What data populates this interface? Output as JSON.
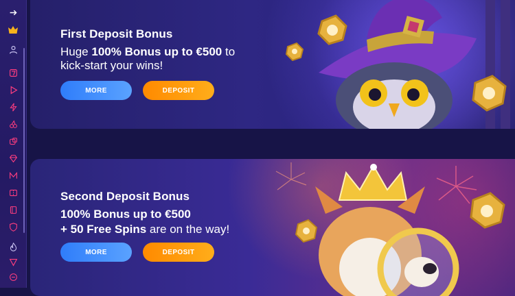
{
  "sidebar": {
    "items": [
      {
        "icon": "arrow-right-icon"
      },
      {
        "icon": "crown-icon"
      },
      {
        "icon": "user-icon"
      },
      {
        "icon": "slot-seven-icon"
      },
      {
        "icon": "play-icon"
      },
      {
        "icon": "lightning-icon"
      },
      {
        "icon": "cherry-icon"
      },
      {
        "icon": "dice-icon"
      },
      {
        "icon": "diamond-icon"
      },
      {
        "icon": "m-logo-icon"
      },
      {
        "icon": "ticket-icon"
      },
      {
        "icon": "book-icon"
      },
      {
        "icon": "shield-icon"
      },
      {
        "icon": "flame-icon"
      },
      {
        "icon": "triangle-down-icon"
      },
      {
        "icon": "chat-icon"
      }
    ]
  },
  "cards": [
    {
      "title": "First Deposit Bonus",
      "line1_prefix": "Huge ",
      "line1_bold": "100% Bonus up to €500",
      "line1_suffix": " to",
      "line2": "kick-start your wins!",
      "more_label": "MORE",
      "deposit_label": "DEPOSIT"
    },
    {
      "title": "Second Deposit Bonus",
      "line1_bold": "100% Bonus up to €500",
      "line2_bold": "+ 50 Free Spins",
      "line2_suffix": " are on the way!",
      "more_label": "MORE",
      "deposit_label": "DEPOSIT"
    }
  ],
  "colors": {
    "more_button": "#3d8bfd",
    "deposit_button": "#ff9800",
    "sidebar_bg": "#2a1f6e",
    "page_bg": "#171447"
  }
}
